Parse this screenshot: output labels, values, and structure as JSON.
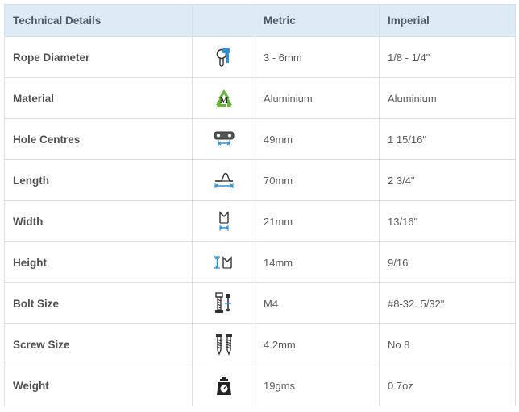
{
  "header": {
    "col_details": "Technical Details",
    "col_icon": "",
    "col_metric": "Metric",
    "col_imperial": "Imperial"
  },
  "rows": [
    {
      "label": "Rope Diameter",
      "icon": "rope-diameter-icon",
      "metric": "3 - 6mm",
      "imperial": "1/8 - 1/4\""
    },
    {
      "label": "Material",
      "icon": "recycle-material-icon",
      "metric": "Aluminium",
      "imperial": "Aluminium"
    },
    {
      "label": "Hole Centres",
      "icon": "hole-centres-icon",
      "metric": "49mm",
      "imperial": "1 15/16\""
    },
    {
      "label": "Length",
      "icon": "length-icon",
      "metric": "70mm",
      "imperial": "2 3/4\""
    },
    {
      "label": "Width",
      "icon": "width-icon",
      "metric": "21mm",
      "imperial": "13/16\""
    },
    {
      "label": "Height",
      "icon": "height-icon",
      "metric": "14mm",
      "imperial": "9/16"
    },
    {
      "label": "Bolt Size",
      "icon": "bolt-size-icon",
      "metric": "M4",
      "imperial": "#8-32. 5/32\""
    },
    {
      "label": "Screw Size",
      "icon": "screw-size-icon",
      "metric": "4.2mm",
      "imperial": "No 8"
    },
    {
      "label": "Weight",
      "icon": "weight-icon",
      "metric": "19gms",
      "imperial": "0.7oz"
    }
  ],
  "colors": {
    "header_bg": "#dcebf5",
    "border": "#d9dee2",
    "accent_blue": "#2f8fd0",
    "recycle_green": "#6db33f"
  }
}
